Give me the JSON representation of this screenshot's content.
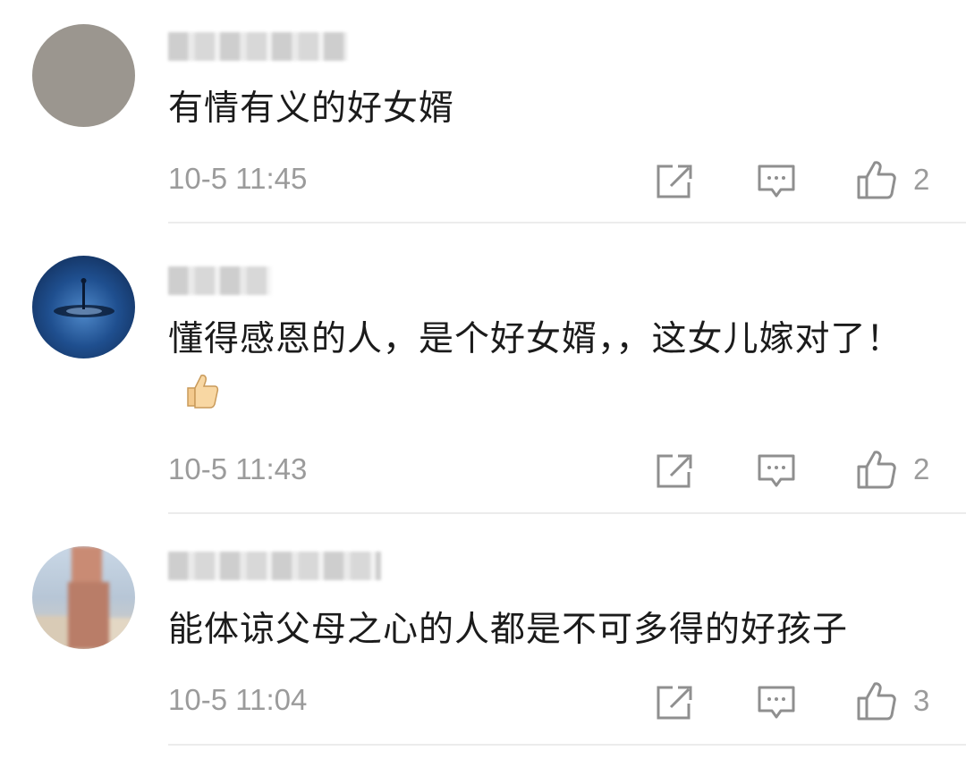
{
  "comments": [
    {
      "text": "有情有义的好女婿",
      "time": "10-5 11:45",
      "likes": "2"
    },
    {
      "text": "懂得感恩的人，是个好女婿，，这女儿嫁对了！",
      "time": "10-5 11:43",
      "likes": "2",
      "emoji": "thumbs-up-emoji"
    },
    {
      "text": "能体谅父母之心的人都是不可多得的好孩子",
      "time": "10-5 11:04",
      "likes": "3"
    }
  ],
  "icons": {
    "share": "share-icon",
    "reply": "reply-icon",
    "like": "like-icon"
  },
  "colors": {
    "meta_text": "#9b9b9b",
    "body_text": "#1b1b1b",
    "icon_stroke": "#8f8f8f"
  }
}
